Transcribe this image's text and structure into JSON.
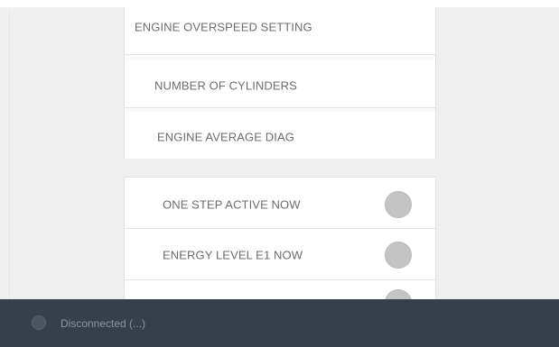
{
  "settings_list": {
    "items": [
      {
        "label": "ENGINE OVERSPEED SETTING"
      },
      {
        "label": "NUMBER OF CYLINDERS"
      },
      {
        "label": "ENGINE AVERAGE DIAG"
      }
    ]
  },
  "status_list": {
    "items": [
      {
        "label": "ONE STEP ACTIVE NOW",
        "state": "off",
        "indicator_icon": "status-circle-icon"
      },
      {
        "label": "ENERGY LEVEL E1 NOW",
        "state": "off",
        "indicator_icon": "status-circle-icon"
      },
      {
        "label": "",
        "state": "off",
        "indicator_icon": "status-circle-icon"
      }
    ]
  },
  "status_bar": {
    "text": "Disconnected (...)",
    "icon": "connection-status-icon"
  },
  "colors": {
    "background": "#efefef",
    "card": "#ffffff",
    "text": "#6d6d6d",
    "indicator_off": "#c4c4c4",
    "status_bar": "#373f4a"
  }
}
